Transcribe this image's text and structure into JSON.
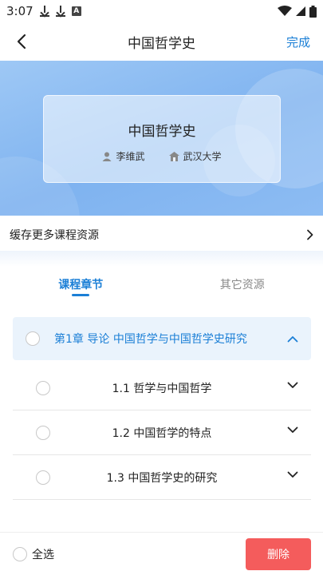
{
  "status_bar": {
    "time": "3:07",
    "icons": [
      "download-icon",
      "download-icon",
      "a-icon",
      "wifi-icon",
      "signal-icon",
      "battery-icon"
    ]
  },
  "nav": {
    "title": "中国哲学史",
    "done_label": "完成"
  },
  "course": {
    "title": "中国哲学史",
    "teacher": "李维武",
    "school": "武汉大学"
  },
  "cache_more": {
    "label": "缓存更多课程资源"
  },
  "tabs": [
    {
      "label": "课程章节",
      "active": true
    },
    {
      "label": "其它资源",
      "active": false
    }
  ],
  "chapter": {
    "title_prefix": "第1章",
    "title": "导论 中国哲学与中国哲学史研究",
    "expanded": true
  },
  "sections": [
    {
      "label": "1.1 哲学与中国哲学"
    },
    {
      "label": "1.2 中国哲学的特点"
    },
    {
      "label": "1.3 中国哲学史的研究"
    }
  ],
  "bottom": {
    "select_all_label": "全选",
    "delete_label": "删除"
  },
  "colors": {
    "accent": "#1b7fd6",
    "delete": "#f45c5c",
    "chapter_bg": "#eaf3fc"
  }
}
